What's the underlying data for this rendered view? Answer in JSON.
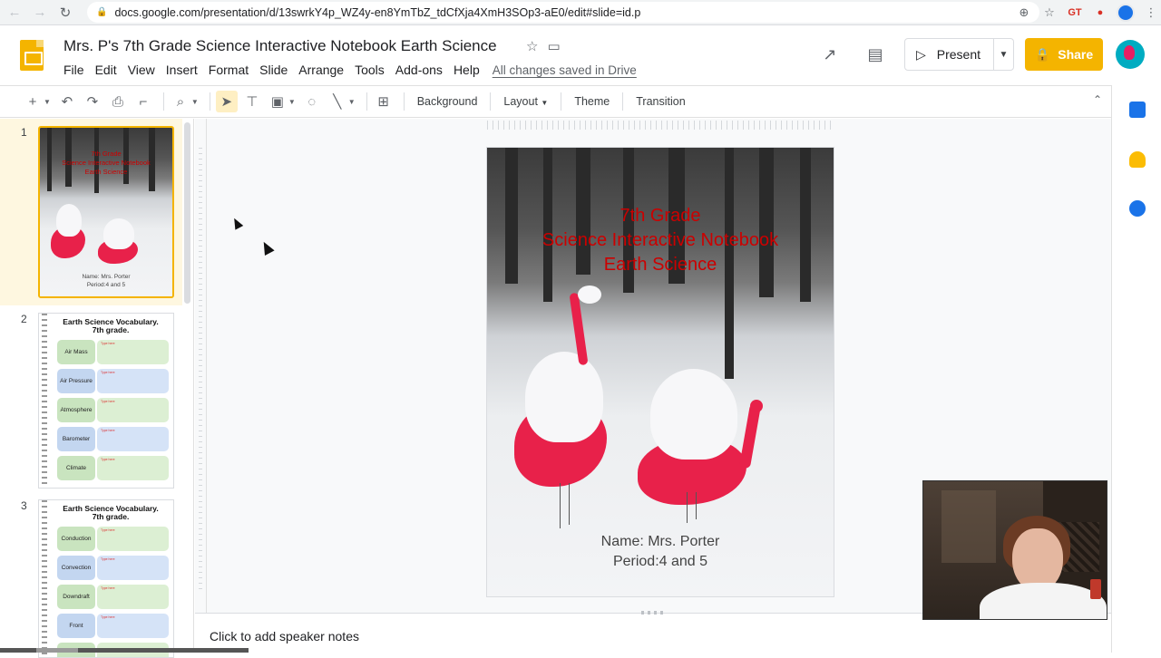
{
  "browser": {
    "url": "docs.google.com/presentation/d/13swrkY4p_WZ4y-en8YmTbZ_tdCfXja4XmH3SOp3-aE0/edit#slide=id.p",
    "ext_label": "GT"
  },
  "doc": {
    "title": "Mrs. P's 7th Grade Science Interactive Notebook Earth Science",
    "saved_status": "All changes saved in Drive"
  },
  "menu": [
    "File",
    "Edit",
    "View",
    "Insert",
    "Format",
    "Slide",
    "Arrange",
    "Tools",
    "Add-ons",
    "Help"
  ],
  "header": {
    "present_label": "Present",
    "share_label": "Share"
  },
  "toolbar": {
    "background_label": "Background",
    "layout_label": "Layout",
    "theme_label": "Theme",
    "transition_label": "Transition"
  },
  "filmstrip": {
    "slides": [
      {
        "number": "1"
      },
      {
        "number": "2",
        "title_line1": "Earth Science Vocabulary.",
        "title_line2": "7th grade.",
        "terms": [
          "Air Mass",
          "Air Pressure",
          "Atmosphere",
          "Barometer",
          "Climate"
        ]
      },
      {
        "number": "3",
        "title_line1": "Earth Science Vocabulary.",
        "title_line2": "7th grade.",
        "terms": [
          "Conduction",
          "Convection",
          "Downdraft",
          "Front",
          ""
        ]
      }
    ],
    "def_placeholder": "Type here"
  },
  "slide": {
    "title_line1": "7th Grade",
    "title_line2": "Science Interactive Notebook",
    "title_line3": "Earth Science",
    "name_line": "Name: Mrs. Porter",
    "period_line": "Period:4 and 5"
  },
  "notes": {
    "placeholder": "Click to add speaker notes"
  },
  "colors": {
    "accent": "#f4b400",
    "title_red": "#cc0000"
  }
}
